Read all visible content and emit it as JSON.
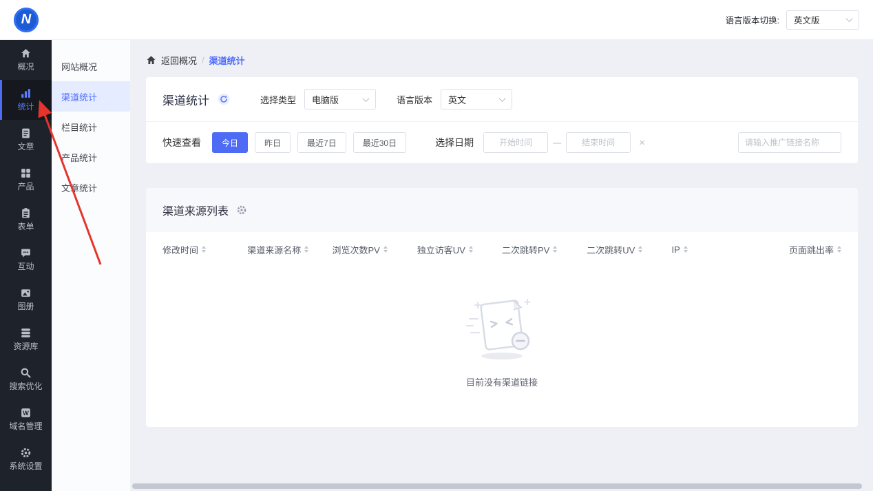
{
  "topbar": {
    "logo_letter": "N",
    "lang_switch_label": "语言版本切换:",
    "lang_value": "英文版"
  },
  "sidebar": {
    "items": [
      {
        "label": "概况",
        "icon": "home-icon",
        "active": false
      },
      {
        "label": "统计",
        "icon": "chart-icon",
        "active": true
      },
      {
        "label": "文章",
        "icon": "article-icon",
        "active": false
      },
      {
        "label": "产品",
        "icon": "product-icon",
        "active": false
      },
      {
        "label": "表单",
        "icon": "form-icon",
        "active": false
      },
      {
        "label": "互动",
        "icon": "chat-icon",
        "active": false
      },
      {
        "label": "图册",
        "icon": "gallery-icon",
        "active": false
      },
      {
        "label": "资源库",
        "icon": "resource-icon",
        "active": false
      },
      {
        "label": "搜索优化",
        "icon": "seo-icon",
        "active": false
      },
      {
        "label": "域名管理",
        "icon": "domain-icon",
        "active": false
      },
      {
        "label": "系统设置",
        "icon": "settings-icon",
        "active": false
      }
    ]
  },
  "submenu": {
    "items": [
      {
        "label": "网站概况",
        "active": false
      },
      {
        "label": "渠道统计",
        "active": true
      },
      {
        "label": "栏目统计",
        "active": false
      },
      {
        "label": "产品统计",
        "active": false
      },
      {
        "label": "文章统计",
        "active": false
      }
    ]
  },
  "breadcrumb": {
    "back_label": "返回概况",
    "separator": "/",
    "current": "渠道统计"
  },
  "filter_panel": {
    "title": "渠道统计",
    "type_label": "选择类型",
    "type_value": "电脑版",
    "language_label": "语言版本",
    "language_value": "英文",
    "quick_view_label": "快速查看",
    "quick_options": [
      {
        "label": "今日",
        "active": true
      },
      {
        "label": "昨日",
        "active": false
      },
      {
        "label": "最近7日",
        "active": false
      },
      {
        "label": "最近30日",
        "active": false
      }
    ],
    "date_label": "选择日期",
    "start_placeholder": "开始时间",
    "range_separator": "—",
    "end_placeholder": "结束时间",
    "clear_icon": "×",
    "promo_search_placeholder": "请输入推广链接名称"
  },
  "source_list": {
    "title": "渠道来源列表",
    "columns": [
      "修改时间",
      "渠道来源名称",
      "浏览次数PV",
      "独立访客UV",
      "二次跳转PV",
      "二次跳转UV",
      "IP",
      "页面跳出率"
    ],
    "empty_text": "目前没有渠道链接"
  },
  "colors": {
    "primary": "#4e6bf5",
    "sidebar_bg": "#1e222a",
    "annotation_arrow": "#e5342c"
  }
}
